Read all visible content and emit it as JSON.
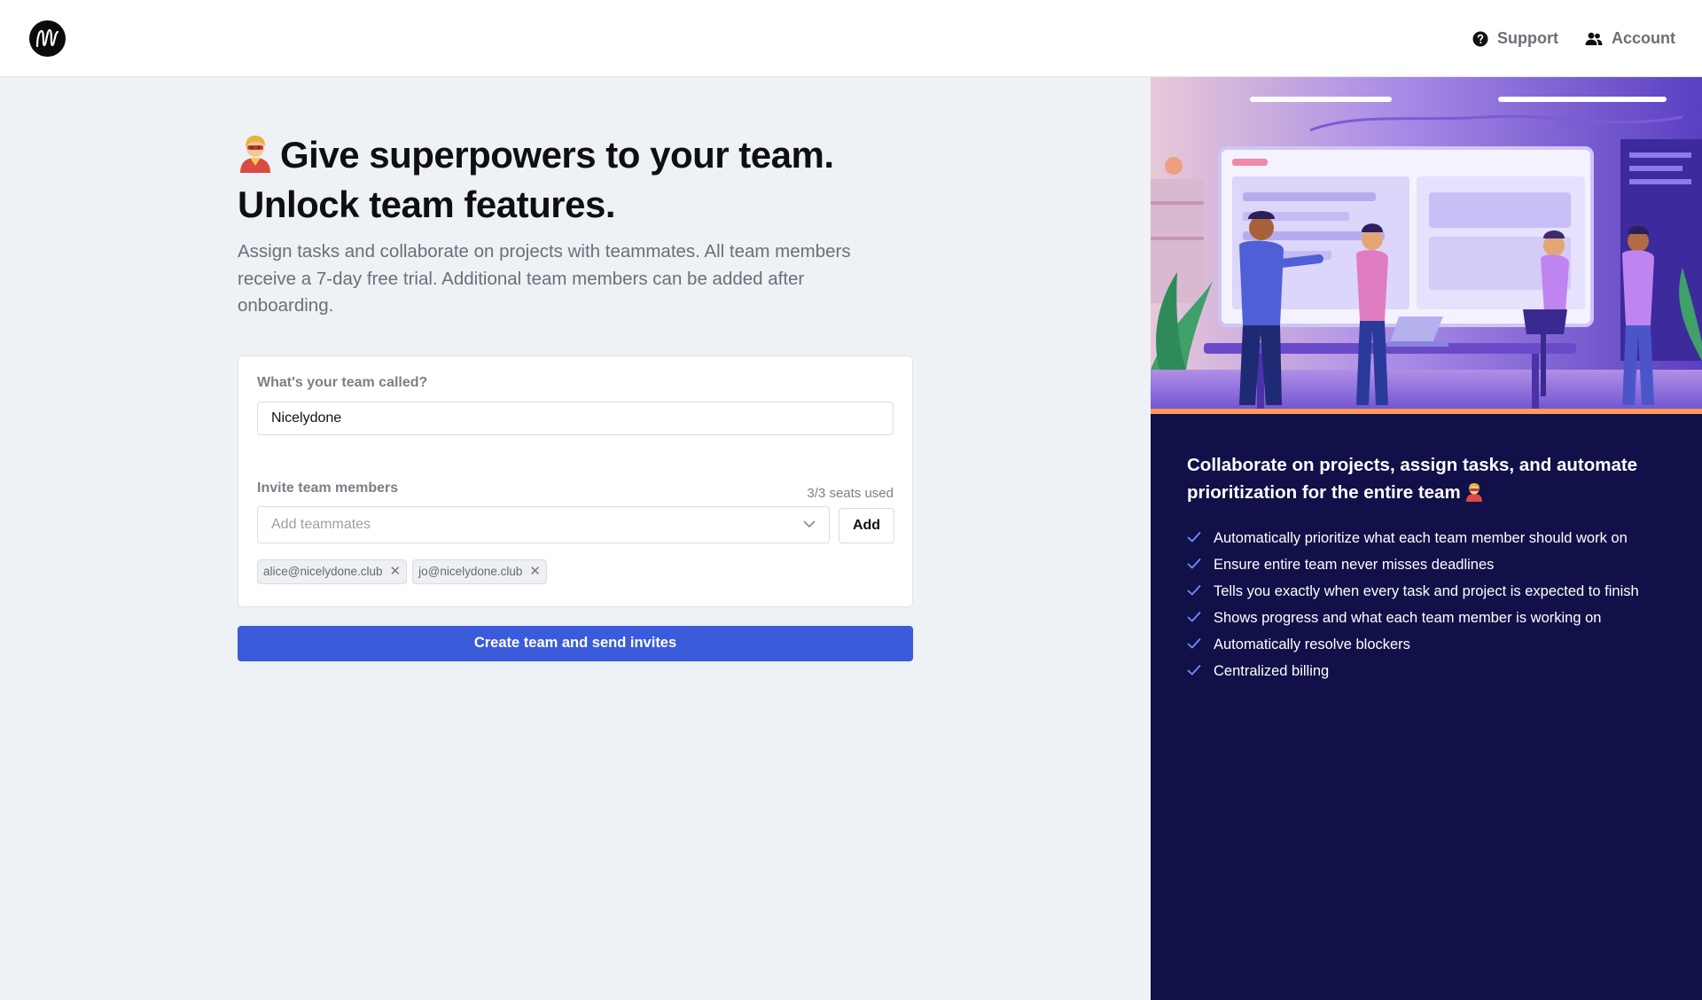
{
  "header": {
    "support_label": "Support",
    "account_label": "Account"
  },
  "main": {
    "headline_line1": "Give superpowers to your team.",
    "headline_line2": "Unlock team features.",
    "subtitle": "Assign tasks and collaborate on projects with teammates. All team members receive a 7-day free trial. Additional team members can be added after onboarding.",
    "team_name_label": "What's your team called?",
    "team_name_value": "Nicelydone",
    "invite_label": "Invite team members",
    "seats_used": "3/3 seats used",
    "teammates_placeholder": "Add teammates",
    "add_button": "Add",
    "invitees": [
      "alice@nicelydone.club",
      "jo@nicelydone.club"
    ],
    "cta_label": "Create team and send invites"
  },
  "promo": {
    "title": "Collaborate on projects, assign tasks, and automate prioritization for the entire team",
    "features": [
      "Automatically prioritize what each team member should work on",
      "Ensure entire team never misses deadlines",
      "Tells you exactly when every task and project is expected to finish",
      "Shows progress and what each team member is working on",
      "Automatically resolve blockers",
      "Centralized billing"
    ]
  },
  "colors": {
    "accent": "#3b5bdb",
    "panel": "#121048",
    "check": "#6f8fff"
  },
  "icons": {
    "support": "help-circle-icon",
    "account": "users-icon",
    "dropdown": "chevron-down-icon",
    "remove": "close-icon",
    "feature": "check-icon"
  }
}
